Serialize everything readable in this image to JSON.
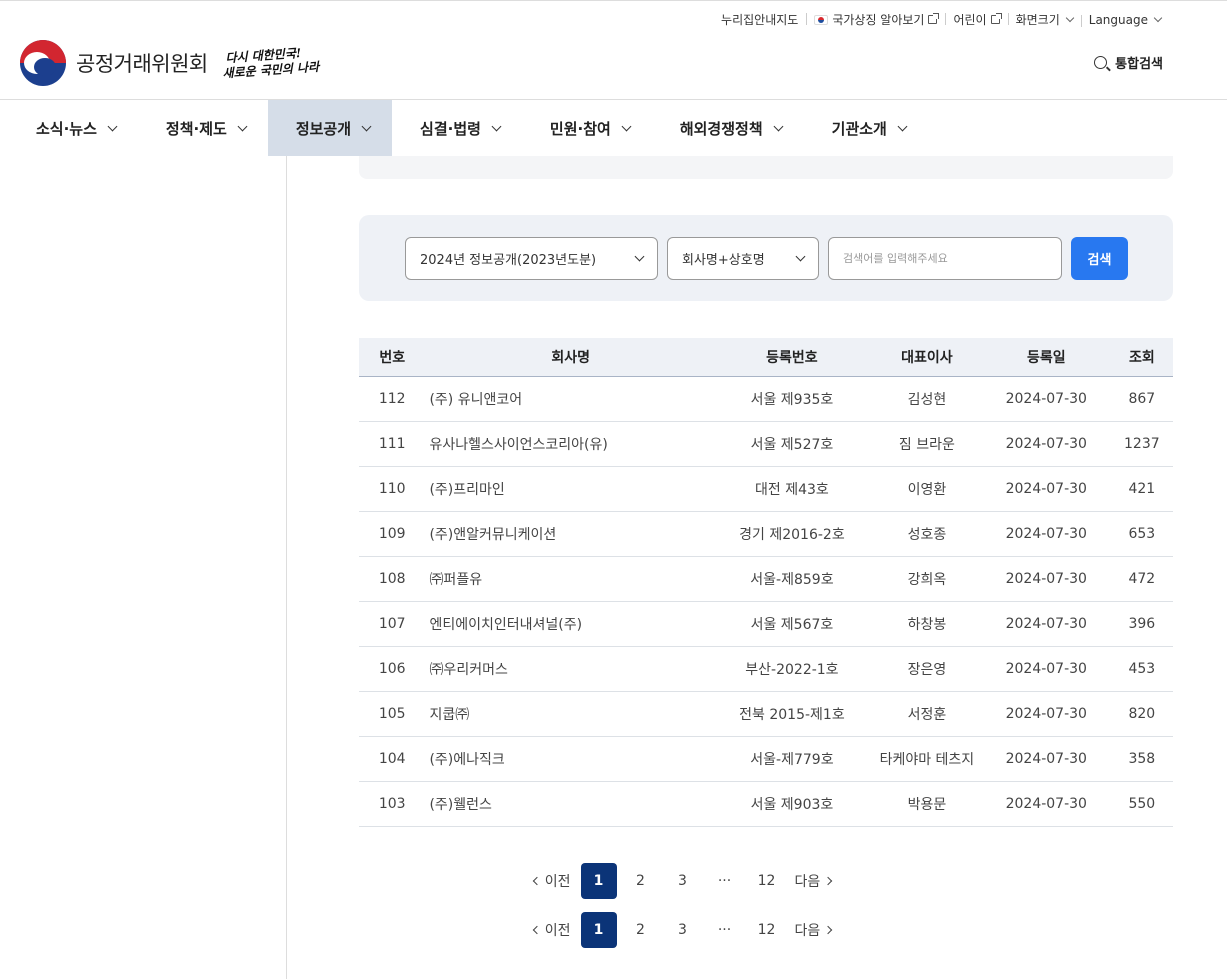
{
  "utility": {
    "sitemap": "누리집안내지도",
    "national_symbols": "국가상징 알아보기",
    "kids": "어린이",
    "font_size": "화면크기",
    "language": "Language"
  },
  "header": {
    "org_name": "공정거래위원회",
    "slogan_line1": "다시 대한민국!",
    "slogan_line2": "새로운 국민의 나라",
    "search_label": "통합검색"
  },
  "gnb": [
    {
      "label": "소식·뉴스"
    },
    {
      "label": "정책·제도"
    },
    {
      "label": "정보공개"
    },
    {
      "label": "심결·법령"
    },
    {
      "label": "민원·참여"
    },
    {
      "label": "해외경쟁정책"
    },
    {
      "label": "기관소개"
    }
  ],
  "search": {
    "year_select": "2024년 정보공개(2023년도분)",
    "field_select": "회사명+상호명",
    "placeholder": "검색어를 입력해주세요",
    "button": "검색"
  },
  "table": {
    "headers": [
      "번호",
      "회사명",
      "등록번호",
      "대표이사",
      "등록일",
      "조회"
    ],
    "rows": [
      [
        "112",
        "(주) 유니앤코어",
        "서울 제935호",
        "김성현",
        "2024-07-30",
        "867"
      ],
      [
        "111",
        "유사나헬스사이언스코리아(유)",
        "서울 제527호",
        "짐 브라운",
        "2024-07-30",
        "1237"
      ],
      [
        "110",
        "(주)프리마인",
        "대전 제43호",
        "이영환",
        "2024-07-30",
        "421"
      ],
      [
        "109",
        "(주)앤알커뮤니케이션",
        "경기 제2016-2호",
        "성호종",
        "2024-07-30",
        "653"
      ],
      [
        "108",
        "㈜퍼플유",
        "서울-제859호",
        "강희옥",
        "2024-07-30",
        "472"
      ],
      [
        "107",
        "엔티에이치인터내셔널(주)",
        "서울 제567호",
        "하창봉",
        "2024-07-30",
        "396"
      ],
      [
        "106",
        "㈜우리커머스",
        "부산-2022-1호",
        "장은영",
        "2024-07-30",
        "453"
      ],
      [
        "105",
        "지쿱㈜",
        "전북 2015-제1호",
        "서정훈",
        "2024-07-30",
        "820"
      ],
      [
        "104",
        "(주)에나직크",
        "서울-제779호",
        "타케야마 테츠지",
        "2024-07-30",
        "358"
      ],
      [
        "103",
        "(주)웰런스",
        "서울 제903호",
        "박용문",
        "2024-07-30",
        "550"
      ]
    ]
  },
  "pagination": {
    "prev": "이전",
    "next": "다음",
    "pages": [
      "1",
      "2",
      "3",
      "···",
      "12"
    ],
    "current": "1"
  },
  "colors": {
    "accent": "#2878f0",
    "pager_current": "#0b3478",
    "active_nav": "#d5dde8"
  }
}
